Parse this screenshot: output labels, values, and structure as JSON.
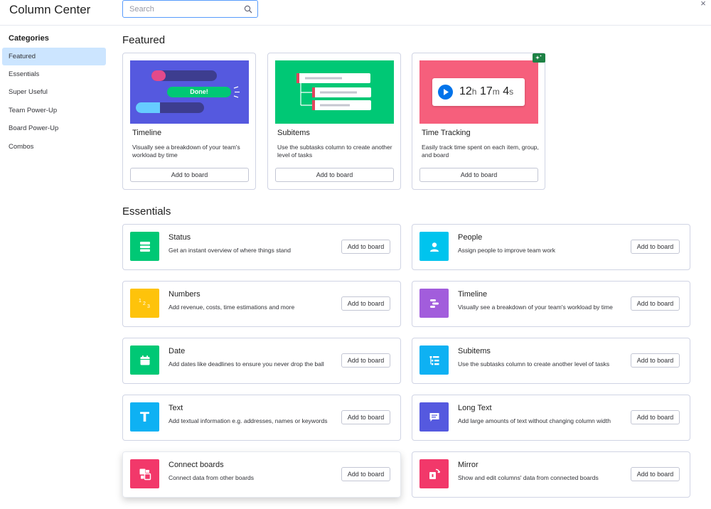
{
  "app": {
    "title": "Column Center",
    "search_placeholder": "Search",
    "close_label": "×"
  },
  "sidebar": {
    "heading": "Categories",
    "items": [
      {
        "label": "Featured",
        "active": true
      },
      {
        "label": "Essentials",
        "active": false
      },
      {
        "label": "Super Useful",
        "active": false
      },
      {
        "label": "Team Power-Up",
        "active": false
      },
      {
        "label": "Board Power-Up",
        "active": false
      },
      {
        "label": "Combos",
        "active": false
      }
    ]
  },
  "featured": {
    "title": "Featured",
    "cards": [
      {
        "name": "Timeline",
        "description": "Visually see a breakdown of your team's workload by time",
        "button": "Add to board",
        "image_bg": "#5559df",
        "image_text": "Done!"
      },
      {
        "name": "Subitems",
        "description": "Use the subtasks column to create another level of tasks",
        "button": "Add to board",
        "image_bg": "#00c875"
      },
      {
        "name": "Time Tracking",
        "description": "Easily track time spent on each item, group, and board",
        "button": "Add to board",
        "image_bg": "#f65f7c",
        "timer": {
          "h": "12",
          "h_unit": "h",
          "m": "17",
          "m_unit": "m",
          "s": "4",
          "s_unit": "s"
        },
        "badge_icon": "sparkle-icon"
      }
    ]
  },
  "essentials": {
    "title": "Essentials",
    "columns": [
      {
        "name": "Status",
        "description": "Get an instant overview of where things stand",
        "button": "Add to board",
        "icon": "status-icon",
        "color": "#00c875"
      },
      {
        "name": "People",
        "description": "Assign people to improve team work",
        "button": "Add to board",
        "icon": "people-icon",
        "color": "#00c4ee"
      },
      {
        "name": "Numbers",
        "description": "Add revenue, costs, time estimations and more",
        "button": "Add to board",
        "icon": "numbers-icon",
        "color": "#fec30b",
        "icon_text": "123"
      },
      {
        "name": "Timeline",
        "description": "Visually see a breakdown of your team's workload by time",
        "button": "Add to board",
        "icon": "timeline-icon",
        "color": "#a25ddc"
      },
      {
        "name": "Date",
        "description": "Add dates like deadlines to ensure you never drop the ball",
        "button": "Add to board",
        "icon": "calendar-icon",
        "color": "#00c875"
      },
      {
        "name": "Subitems",
        "description": "Use the subtasks column to create another level of tasks",
        "button": "Add to board",
        "icon": "subitems-icon",
        "color": "#0eb1f3"
      },
      {
        "name": "Text",
        "description": "Add textual information e.g. addresses, names or keywords",
        "button": "Add to board",
        "icon": "text-icon",
        "color": "#0eb1f3",
        "icon_text": "T"
      },
      {
        "name": "Long Text",
        "description": "Add large amounts of text without changing column width",
        "button": "Add to board",
        "icon": "long-text-icon",
        "color": "#5559df"
      },
      {
        "name": "Connect boards",
        "description": "Connect data from other boards",
        "button": "Add to board",
        "icon": "connect-boards-icon",
        "color": "#f2386a"
      },
      {
        "name": "Mirror",
        "description": "Show and edit columns' data from connected boards",
        "button": "Add to board",
        "icon": "mirror-icon",
        "color": "#f2386a"
      }
    ]
  }
}
